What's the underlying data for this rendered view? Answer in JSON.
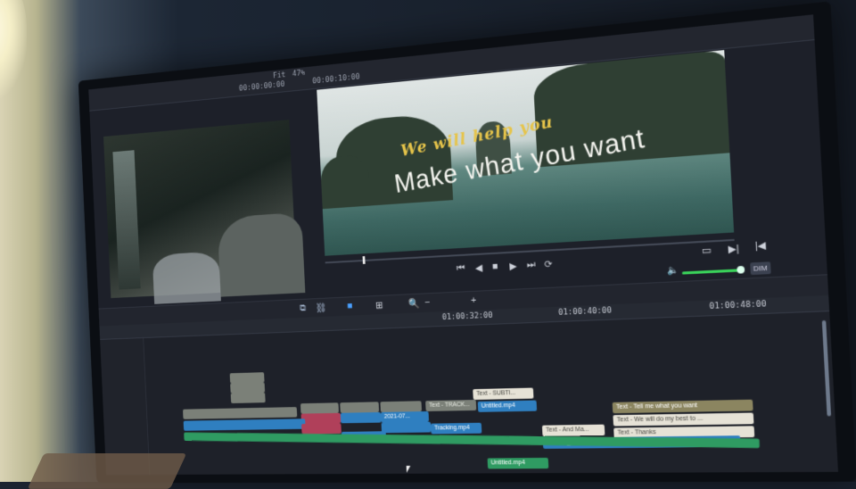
{
  "window": {
    "title_small": "Fit",
    "zoom": "47%",
    "source_timecode": "00:00:00:00",
    "program_timecode": "00:00:10:00"
  },
  "program": {
    "overlay_line1": "We will help you",
    "overlay_line2": "Make  what you want"
  },
  "transport": {
    "icons": [
      "skip-back-icon",
      "prev-frame-icon",
      "stop-icon",
      "play-icon",
      "skip-forward-icon",
      "loop-icon"
    ],
    "right_icons": [
      "fullscreen-icon",
      "next-edit-icon",
      "first-frame-icon"
    ],
    "dim_label": "DIM",
    "volume_level": 0.85
  },
  "ruler": {
    "timecodes": [
      "01:00:32:00",
      "01:00:40:00",
      "01:00:48:00"
    ]
  },
  "timeline": {
    "clips": [
      {
        "label": "Text - SUBTI...",
        "color": "white"
      },
      {
        "label": "Untitled.mp4",
        "color": "blue"
      },
      {
        "label": "Text - Tell me what you want",
        "color": "khaki"
      },
      {
        "label": "Text - We will do my best to ...",
        "color": "white"
      },
      {
        "label": "Text - And Ma...",
        "color": "white"
      },
      {
        "label": "Text - Thanks",
        "color": "white"
      },
      {
        "label": "210108_01_Snowy Woods_4k_039.mp4",
        "color": "blue"
      },
      {
        "label": "Tracking.mp4",
        "color": "blue"
      },
      {
        "label": "2021-07...",
        "color": "blue"
      },
      {
        "label": "Text - TRACK...",
        "color": "grey"
      },
      {
        "label": "Untitled.mp4",
        "color": "green"
      }
    ]
  },
  "colors": {
    "accent_blue": "#2f7fc0",
    "accent_green": "#2f9b62",
    "title_yellow": "#e6c44a"
  }
}
